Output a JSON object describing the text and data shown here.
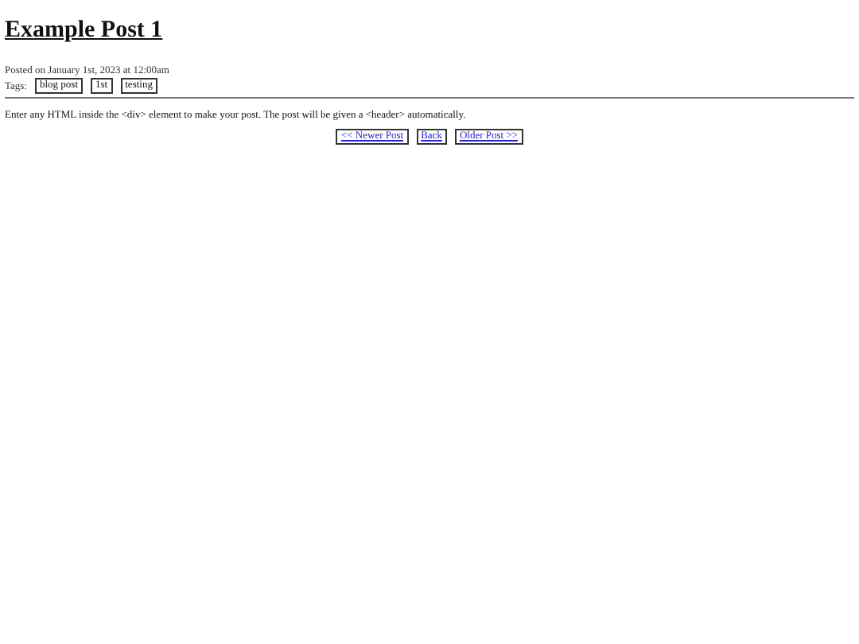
{
  "post": {
    "title": "Example Post 1",
    "posted": "Posted on January 1st, 2023 at 12:00am",
    "tags_label": "Tags:",
    "tags": [
      "blog post",
      "1st",
      "testing"
    ],
    "body": "Enter any HTML inside the <div> element to make your post. The post will be given a <header> automatically."
  },
  "nav": [
    "<< Newer Post",
    "Back",
    "Older Post >>"
  ]
}
